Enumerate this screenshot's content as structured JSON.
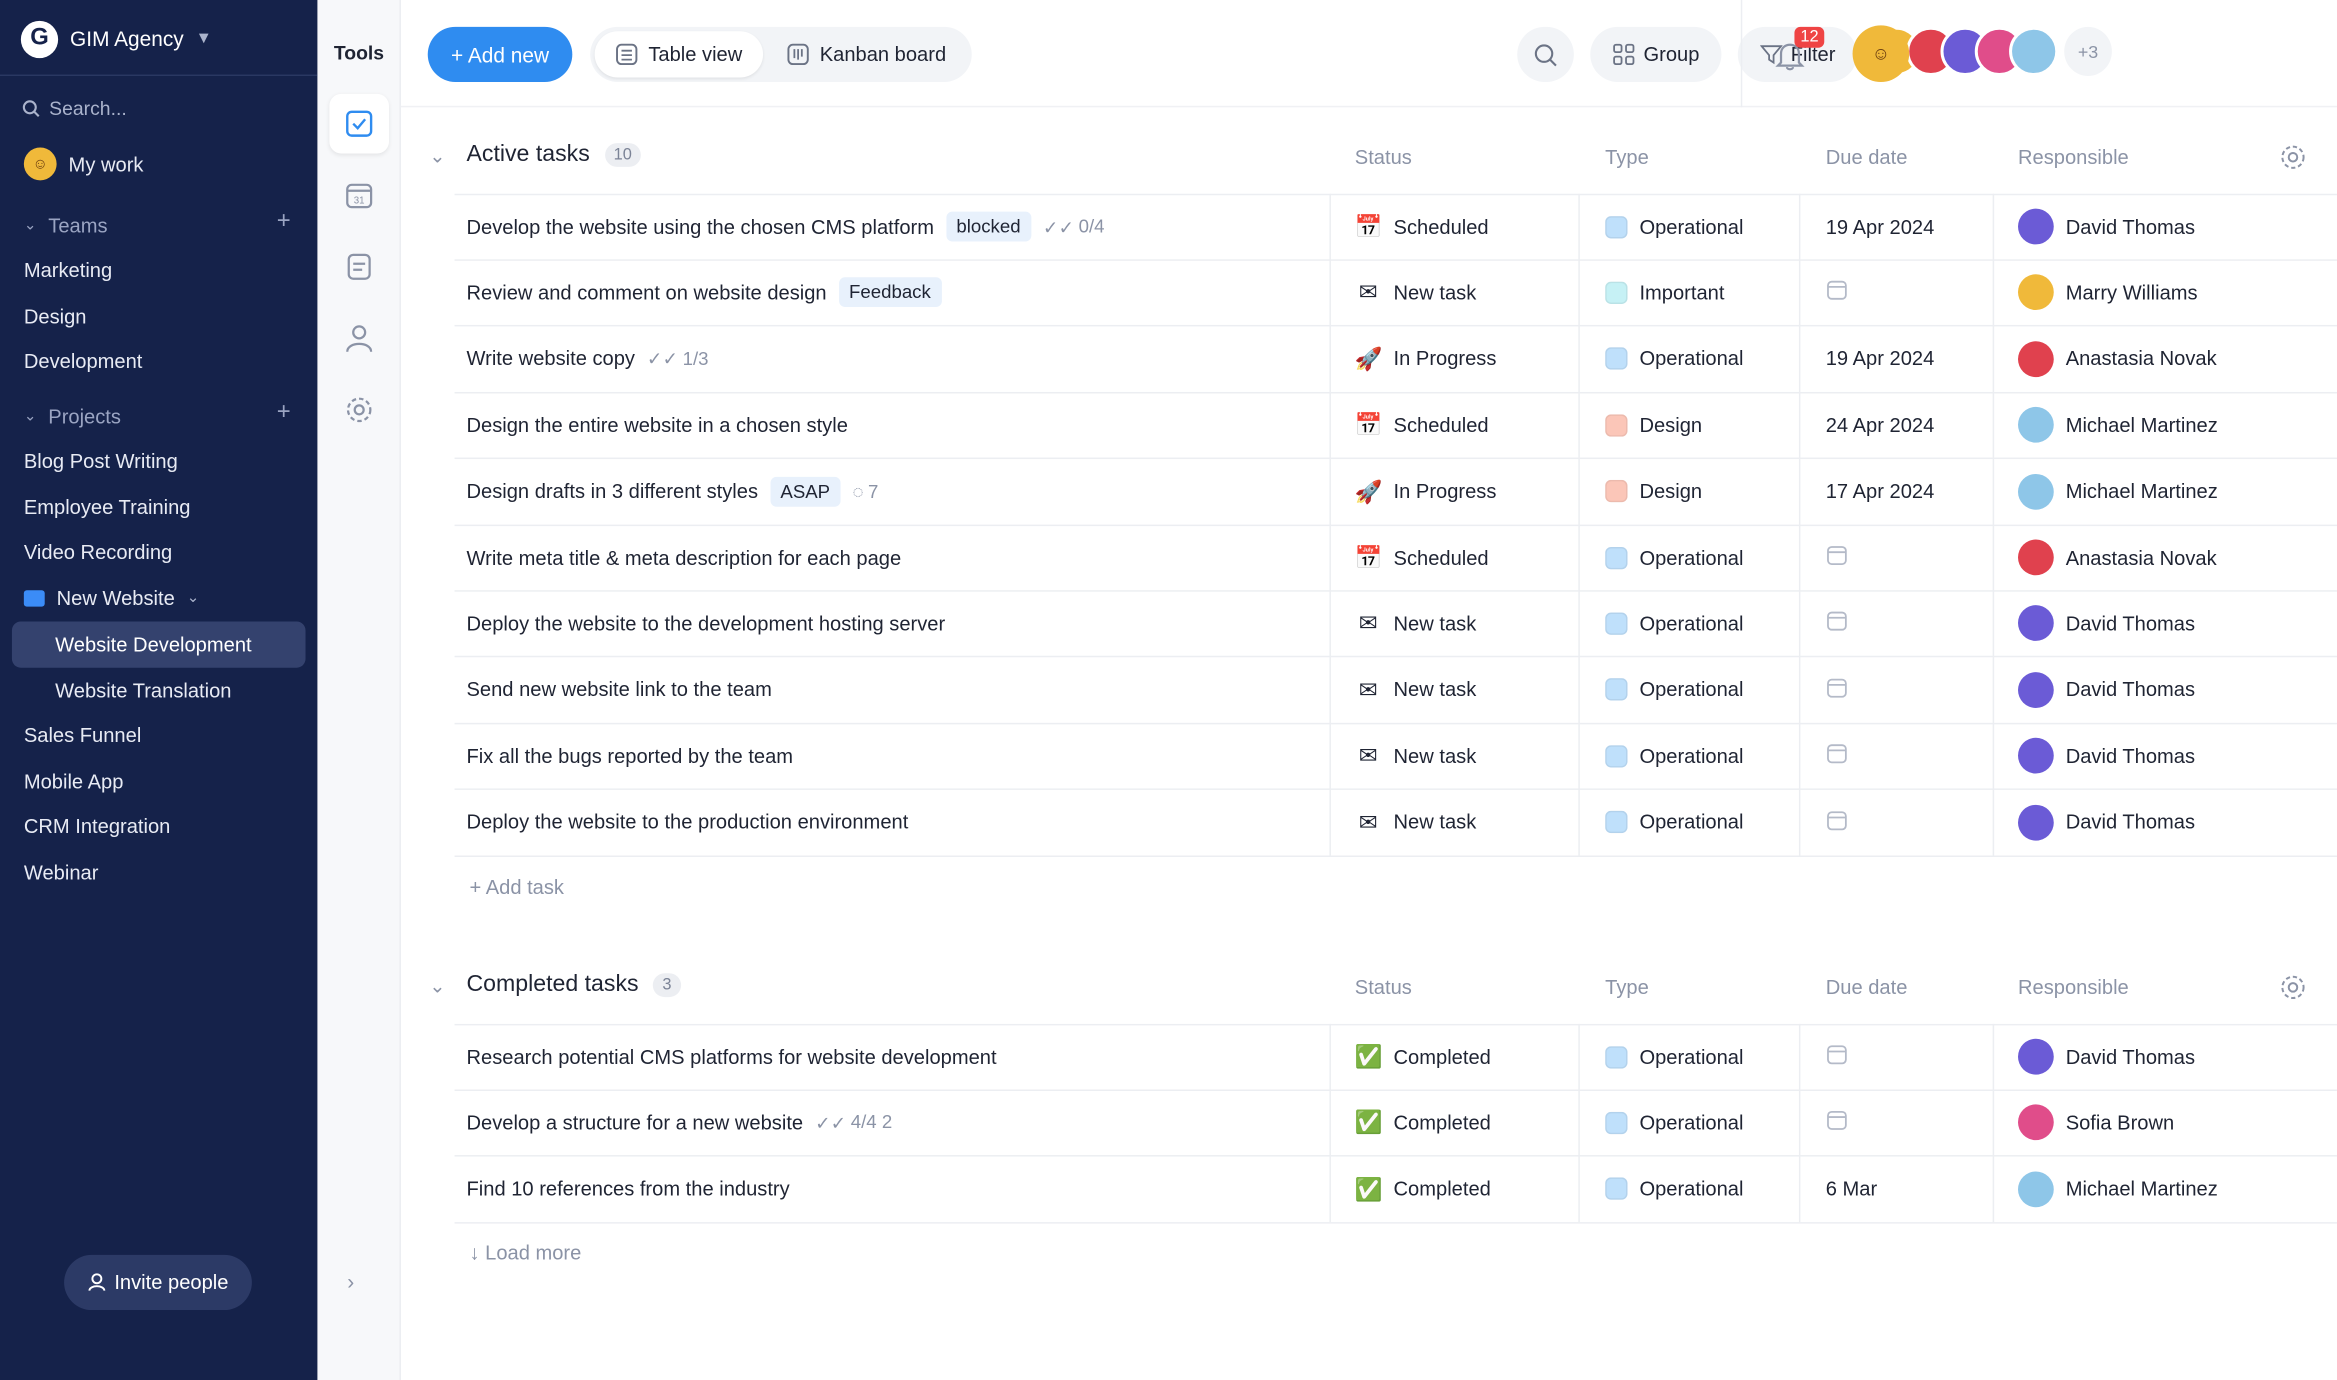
{
  "sidebar": {
    "workspace": "GIM Agency",
    "search_placeholder": "Search...",
    "my_work": "My work",
    "teams_label": "Teams",
    "teams": [
      "Marketing",
      "Design",
      "Development"
    ],
    "projects_label": "Projects",
    "projects_top": [
      "Blog Post Writing",
      "Employee Training",
      "Video Recording"
    ],
    "folder": "New Website",
    "folder_children": [
      "Website Development",
      "Website Translation"
    ],
    "projects_bottom": [
      "Sales Funnel",
      "Mobile App",
      "CRM Integration",
      "Webinar"
    ],
    "invite": "Invite people"
  },
  "tools": {
    "title": "Tools"
  },
  "toolbar": {
    "add_new": "+ Add new",
    "table_view": "Table view",
    "kanban": "Kanban board",
    "group": "Group",
    "filter": "Filter",
    "more_members": "+3",
    "notifications": "12"
  },
  "columns": {
    "status": "Status",
    "type": "Type",
    "due": "Due date",
    "responsible": "Responsible"
  },
  "active": {
    "title": "Active tasks",
    "count": "10",
    "rows": [
      {
        "name": "Develop the website using the chosen CMS platform",
        "tag": "blocked",
        "meta": "0/4",
        "status": "Scheduled",
        "status_icon": "📅",
        "type": "Operational",
        "type_color": "#bfe0fb",
        "due": "19 Apr 2024",
        "resp": "David Thomas",
        "resp_color": "#6b5bd6"
      },
      {
        "name": "Review and comment on website design",
        "tag": "Feedback",
        "meta": "",
        "status": "New task",
        "status_icon": "✉",
        "type": "Important",
        "type_color": "#c6f1f5",
        "due": "",
        "resp": "Marry Williams",
        "resp_color": "#f0b93a"
      },
      {
        "name": "Write website copy",
        "tag": "",
        "meta": "1/3",
        "status": "In Progress",
        "status_icon": "🚀",
        "type": "Operational",
        "type_color": "#bfe0fb",
        "due": "19 Apr 2024",
        "resp": "Anastasia Novak",
        "resp_color": "#e0414e"
      },
      {
        "name": "Design the entire website in a chosen style",
        "tag": "",
        "meta": "",
        "status": "Scheduled",
        "status_icon": "📅",
        "type": "Design",
        "type_color": "#fbc6b8",
        "due": "24 Apr 2024",
        "resp": "Michael Martinez",
        "resp_color": "#8ec6e8"
      },
      {
        "name": "Design drafts in 3 different styles",
        "tag": "ASAP",
        "meta": "7",
        "status": "In Progress",
        "status_icon": "🚀",
        "type": "Design",
        "type_color": "#fbc6b8",
        "due": "17 Apr 2024",
        "resp": "Michael Martinez",
        "resp_color": "#8ec6e8"
      },
      {
        "name": "Write meta title & meta description for each page",
        "tag": "",
        "meta": "",
        "status": "Scheduled",
        "status_icon": "📅",
        "type": "Operational",
        "type_color": "#bfe0fb",
        "due": "",
        "resp": "Anastasia Novak",
        "resp_color": "#e0414e"
      },
      {
        "name": "Deploy the website to the development hosting server",
        "tag": "",
        "meta": "",
        "status": "New task",
        "status_icon": "✉",
        "type": "Operational",
        "type_color": "#bfe0fb",
        "due": "",
        "resp": "David Thomas",
        "resp_color": "#6b5bd6"
      },
      {
        "name": "Send new website link to the team",
        "tag": "",
        "meta": "",
        "status": "New task",
        "status_icon": "✉",
        "type": "Operational",
        "type_color": "#bfe0fb",
        "due": "",
        "resp": "David Thomas",
        "resp_color": "#6b5bd6"
      },
      {
        "name": "Fix all the bugs reported by the team",
        "tag": "",
        "meta": "",
        "status": "New task",
        "status_icon": "✉",
        "type": "Operational",
        "type_color": "#bfe0fb",
        "due": "",
        "resp": "David Thomas",
        "resp_color": "#6b5bd6"
      },
      {
        "name": "Deploy the website to the production environment",
        "tag": "",
        "meta": "",
        "status": "New task",
        "status_icon": "✉",
        "type": "Operational",
        "type_color": "#bfe0fb",
        "due": "",
        "resp": "David Thomas",
        "resp_color": "#6b5bd6"
      }
    ],
    "add_task": "+ Add task"
  },
  "completed": {
    "title": "Completed tasks",
    "count": "3",
    "rows": [
      {
        "name": "Research potential CMS platforms for website development",
        "tag": "",
        "meta": "",
        "status": "Completed",
        "status_icon": "✅",
        "type": "Operational",
        "type_color": "#bfe0fb",
        "due": "",
        "resp": "David Thomas",
        "resp_color": "#6b5bd6"
      },
      {
        "name": "Develop a structure for a new website",
        "tag": "",
        "meta": "4/4  2",
        "status": "Completed",
        "status_icon": "✅",
        "type": "Operational",
        "type_color": "#bfe0fb",
        "due": "",
        "resp": "Sofia Brown",
        "resp_color": "#e04d8a"
      },
      {
        "name": "Find 10 references from the industry",
        "tag": "",
        "meta": "",
        "status": "Completed",
        "status_icon": "✅",
        "type": "Operational",
        "type_color": "#bfe0fb",
        "due": "6 Mar",
        "resp": "Michael Martinez",
        "resp_color": "#8ec6e8"
      }
    ],
    "load_more": "↓ Load more"
  }
}
